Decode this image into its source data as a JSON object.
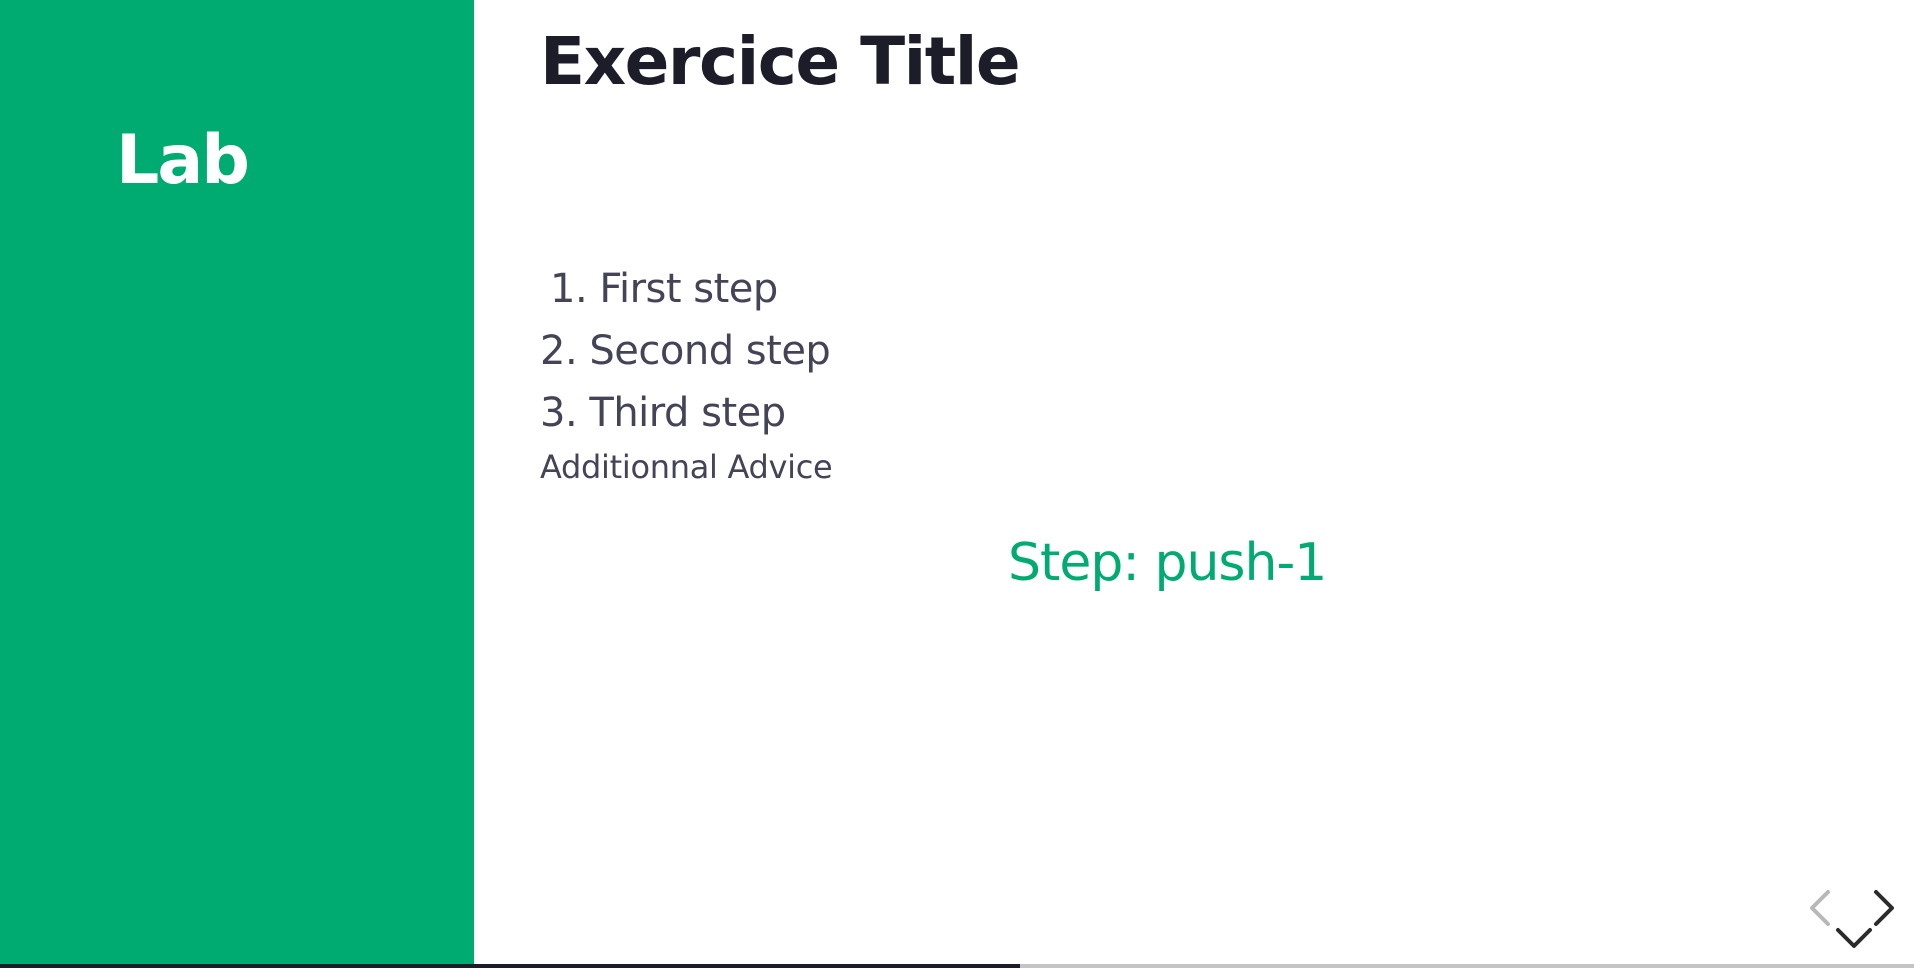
{
  "sidebar": {
    "title": "Lab",
    "background_color": "#00ab72"
  },
  "main": {
    "title": "Exercice Title",
    "steps": [
      "1. First step",
      "2. Second step",
      "3. Third step"
    ],
    "advice": "Additionnal Advice",
    "step_indicator": "Step: push-1"
  },
  "navigation": {
    "prev_icon": "chevron-left-icon",
    "next_icon": "chevron-right-icon",
    "down_icon": "chevron-down-icon"
  },
  "progress": {
    "fraction": 0.533
  },
  "colors": {
    "accent": "#00ab72",
    "heading": "#1d1d29",
    "body_text": "#444456",
    "nav_enabled": "#2b2b2b",
    "nav_disabled": "#b8b8b8"
  }
}
